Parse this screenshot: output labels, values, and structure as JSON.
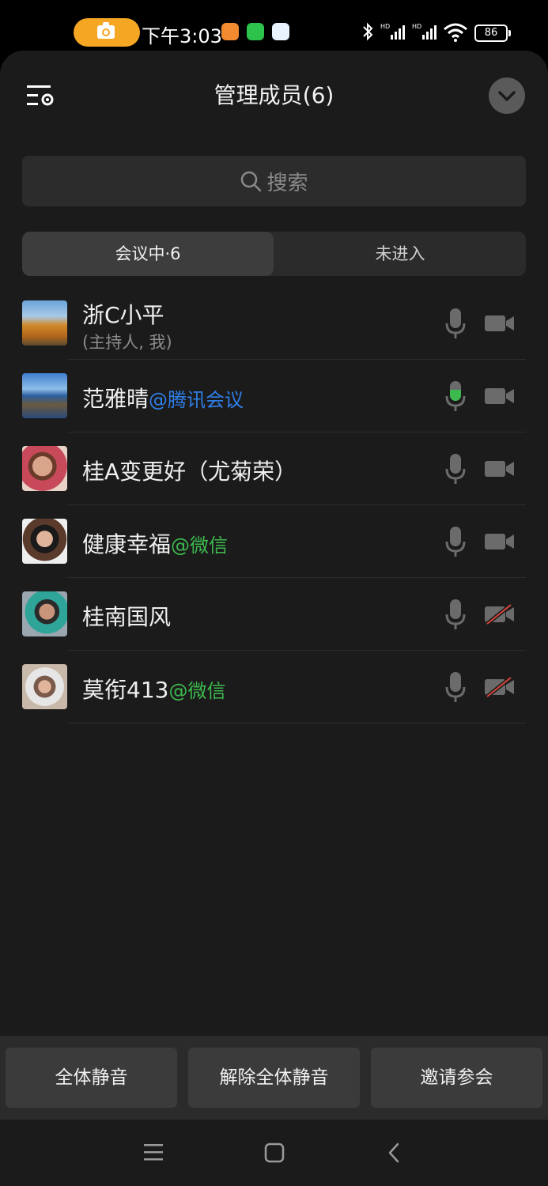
{
  "status_bar": {
    "time": "下午3:03",
    "battery": "86"
  },
  "header": {
    "title": "管理成员(6)"
  },
  "search": {
    "placeholder": "搜索"
  },
  "tabs": [
    {
      "label": "会议中·6",
      "active": true
    },
    {
      "label": "未进入",
      "active": false
    }
  ],
  "members": [
    {
      "name": "浙C小平",
      "tag": "",
      "tag_color": "",
      "sub": "(主持人, 我)",
      "mic": "muted",
      "video": "off_gray"
    },
    {
      "name": "范雅晴",
      "tag": "@腾讯会议",
      "tag_color": "#2f7fe8",
      "sub": "",
      "mic": "active",
      "video": "off_gray"
    },
    {
      "name": "桂A变更好（尤菊荣）",
      "tag": "",
      "tag_color": "",
      "sub": "",
      "mic": "muted",
      "video": "off_gray"
    },
    {
      "name": "健康幸福",
      "tag": "@微信",
      "tag_color": "#3dba4e",
      "sub": "",
      "mic": "muted",
      "video": "off_gray"
    },
    {
      "name": "桂南国风",
      "tag": "",
      "tag_color": "",
      "sub": "",
      "mic": "muted",
      "video": "off_red"
    },
    {
      "name": "莫衔413",
      "tag": "@微信",
      "tag_color": "#3dba4e",
      "sub": "",
      "mic": "muted",
      "video": "off_red"
    }
  ],
  "bottom_buttons": {
    "mute_all": "全体静音",
    "unmute_all": "解除全体静音",
    "invite": "邀请参会"
  },
  "colors": {
    "accent_green": "#3dba4e",
    "accent_blue": "#2f7fe8",
    "panel_bg": "#1b1b1b"
  }
}
